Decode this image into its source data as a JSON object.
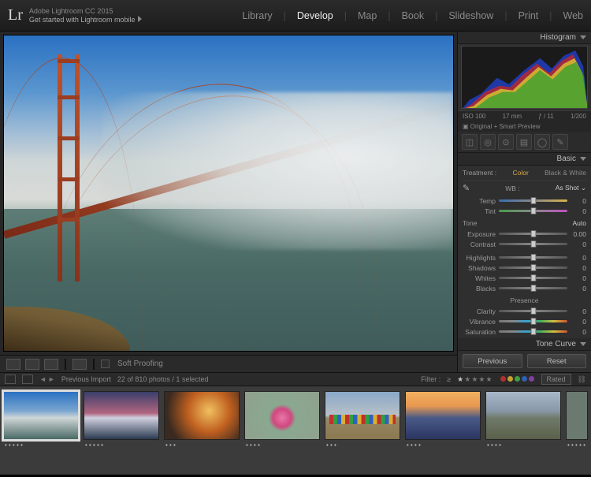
{
  "app": {
    "edition": "Adobe Lightroom CC 2015",
    "tagline": "Get started with Lightroom mobile",
    "logo": "Lr"
  },
  "modules": {
    "items": [
      "Library",
      "Develop",
      "Map",
      "Book",
      "Slideshow",
      "Print",
      "Web"
    ],
    "active": "Develop"
  },
  "canvas_toolbar": {
    "soft_proofing": "Soft Proofing"
  },
  "histogram": {
    "title": "Histogram",
    "meta": {
      "iso": "ISO 100",
      "focal": "17 mm",
      "aperture": "ƒ / 11",
      "shutter": "1/200"
    },
    "preview_label": "Original + Smart Preview"
  },
  "tool_icons": [
    "crop",
    "spot",
    "redeye",
    "gradient",
    "radial",
    "brush"
  ],
  "basic": {
    "title": "Basic",
    "treatment_label": "Treatment :",
    "treatment_color": "Color",
    "treatment_bw": "Black & White",
    "wb_label": "WB :",
    "wb_value": "As Shot",
    "temp": {
      "label": "Temp",
      "value": "0",
      "pos": 50
    },
    "tint": {
      "label": "Tint",
      "value": "0",
      "pos": 50
    },
    "tone_label": "Tone",
    "auto_label": "Auto",
    "exposure": {
      "label": "Exposure",
      "value": "0.00",
      "pos": 50
    },
    "contrast": {
      "label": "Contrast",
      "value": "0",
      "pos": 50
    },
    "highlights": {
      "label": "Highlights",
      "value": "0",
      "pos": 50
    },
    "shadows": {
      "label": "Shadows",
      "value": "0",
      "pos": 50
    },
    "whites": {
      "label": "Whites",
      "value": "0",
      "pos": 50
    },
    "blacks": {
      "label": "Blacks",
      "value": "0",
      "pos": 50
    },
    "presence_label": "Presence",
    "clarity": {
      "label": "Clarity",
      "value": "0",
      "pos": 50
    },
    "vibrance": {
      "label": "Vibrance",
      "value": "0",
      "pos": 50
    },
    "saturation": {
      "label": "Saturation",
      "value": "0",
      "pos": 50
    }
  },
  "tone_curve": {
    "title": "Tone Curve"
  },
  "buttons": {
    "previous": "Previous",
    "reset": "Reset"
  },
  "filmstrip_header": {
    "source": "Previous Import",
    "count": "22 of 810 photos / 1 selected",
    "filter_label": "Filter :",
    "rating_label": "≥",
    "filter_preset": "Rated"
  },
  "thumbs": [
    {
      "rating": "• • • • •"
    },
    {
      "rating": "• • • • •"
    },
    {
      "rating": "• • •"
    },
    {
      "rating": "• • • •"
    },
    {
      "rating": "• • •"
    },
    {
      "rating": "• • • •"
    },
    {
      "rating": "• • • •"
    },
    {
      "rating": "• • • • •"
    }
  ]
}
